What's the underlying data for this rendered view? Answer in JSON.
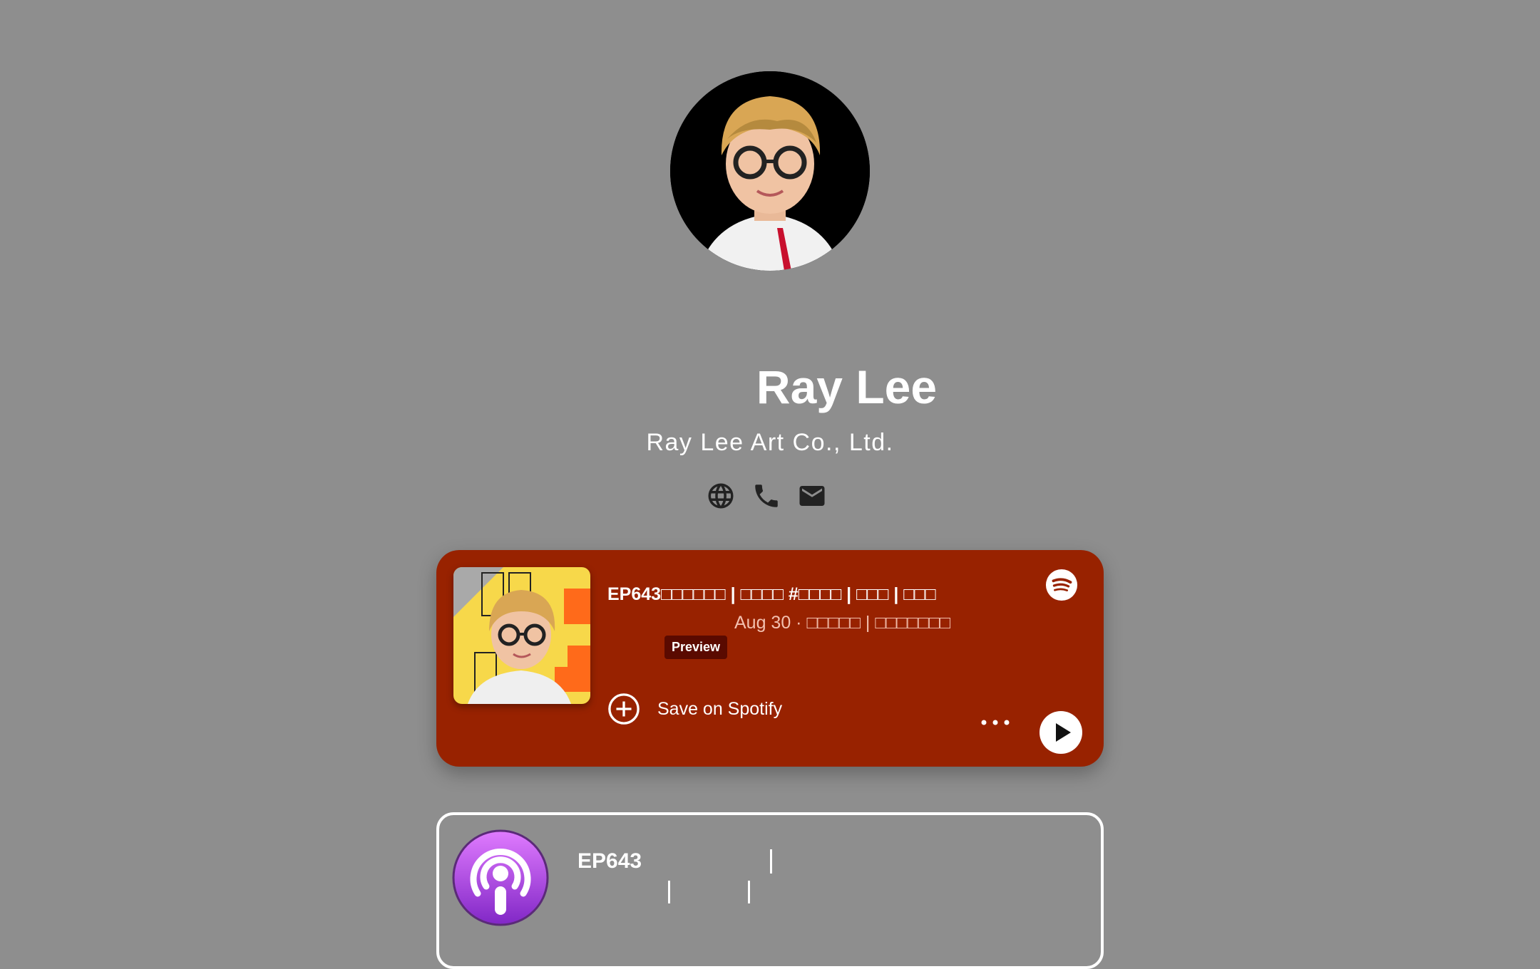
{
  "profile": {
    "name": "Ray Lee",
    "company": "Ray Lee Art Co., Ltd."
  },
  "contact_icons": [
    "globe-icon",
    "phone-icon",
    "mail-icon"
  ],
  "spotify": {
    "title": "EP643□□□□□□ | □□□□ #□□□□ | □□□ | □□□",
    "meta": "Aug 30 · □□□□□ | □□□□□□□",
    "preview_label": "Preview",
    "save_label": "Save on Spotify",
    "background_color": "#982200"
  },
  "apple_podcasts": {
    "title": "EP643"
  }
}
